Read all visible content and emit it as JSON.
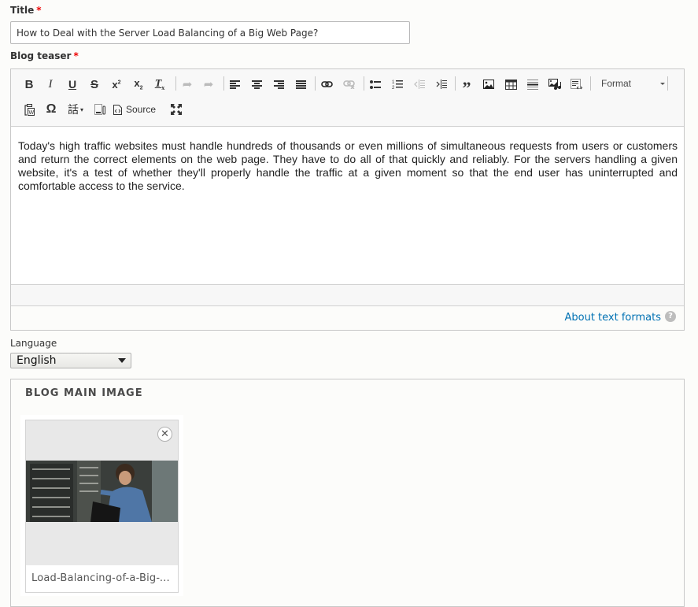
{
  "title_field": {
    "label": "Title",
    "required_marker": "*",
    "value": "How to Deal with the Server Load Balancing of a Big Web Page?"
  },
  "teaser_field": {
    "label": "Blog teaser",
    "required_marker": "*",
    "toolbar": {
      "row1": [
        {
          "name": "bold",
          "glyph": "B"
        },
        {
          "name": "italic",
          "glyph": "I"
        },
        {
          "name": "underline",
          "glyph": "U"
        },
        {
          "name": "strikethrough",
          "glyph": "S"
        },
        {
          "name": "superscript",
          "glyph": "x²"
        },
        {
          "name": "subscript",
          "glyph": "x₂"
        },
        {
          "name": "remove-format",
          "glyph": "Tx"
        },
        {
          "name": "undo",
          "glyph": "↶",
          "disabled": true
        },
        {
          "name": "redo",
          "glyph": "↷",
          "disabled": true
        },
        {
          "name": "align-left"
        },
        {
          "name": "align-center"
        },
        {
          "name": "align-right"
        },
        {
          "name": "justify"
        },
        {
          "name": "link"
        },
        {
          "name": "unlink",
          "disabled": true
        },
        {
          "name": "bulleted-list"
        },
        {
          "name": "numbered-list"
        },
        {
          "name": "outdent",
          "disabled": true
        },
        {
          "name": "indent"
        },
        {
          "name": "blockquote",
          "glyph": "❞"
        },
        {
          "name": "image"
        },
        {
          "name": "table"
        },
        {
          "name": "horizontal-rule"
        },
        {
          "name": "media"
        },
        {
          "name": "template"
        }
      ],
      "format_label": "Format",
      "row2": [
        {
          "name": "paste-from-word"
        },
        {
          "name": "special-character",
          "glyph": "Ω"
        },
        {
          "name": "language"
        },
        {
          "name": "show-blocks"
        }
      ],
      "source_label": "Source",
      "maximize": "maximize"
    },
    "content": "Today's high traffic websites must handle hundreds of thousands or even millions of simultaneous requests from users or customers and return the correct elements on the web page. They have to do all of that quickly and reliably. For the servers handling a given website, it's a test of whether they'll properly handle the traffic at a given moment so that the end user has uninterrupted and comfortable access to the service.",
    "about_text_formats": "About text formats",
    "help_glyph": "?"
  },
  "language_field": {
    "label": "Language",
    "selected": "English"
  },
  "main_image": {
    "legend": "BLOG MAIN IMAGE",
    "filename": "Load-Balancing-of-a-Big-Web-Page",
    "remove_glyph": "✕"
  }
}
